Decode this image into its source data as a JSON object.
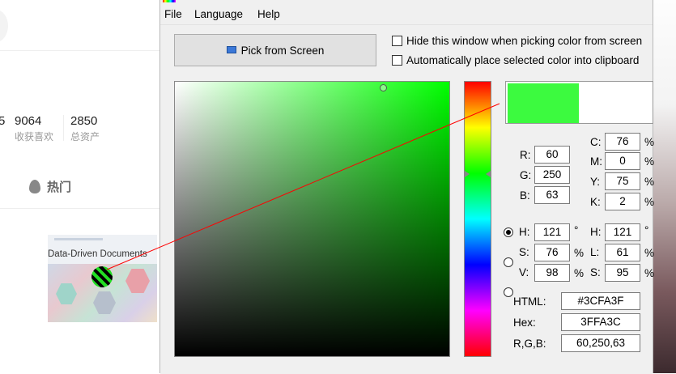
{
  "background_page": {
    "stats": [
      {
        "num": "5",
        "label": ""
      },
      {
        "num": "9064",
        "label": "收获喜欢"
      },
      {
        "num": "2850",
        "label": "总资产"
      }
    ],
    "hot_tab": "热门",
    "thumb_title": "Data-Driven Documents"
  },
  "menu": {
    "file": "File",
    "language": "Language",
    "help": "Help"
  },
  "pick_button": "Pick from Screen",
  "options": {
    "hide_window": "Hide this window when picking color from screen",
    "auto_clipboard": "Automatically place selected color into clipboard"
  },
  "colors": {
    "selected": "#3CFA3F",
    "base_hue": "#00ff00",
    "line": "#ff0000"
  },
  "rgb": {
    "r": "60",
    "g": "250",
    "b": "63"
  },
  "cmyk": {
    "c": "76",
    "m": "0",
    "y": "75",
    "k": "2"
  },
  "hsv": {
    "h": "121",
    "s": "76",
    "v": "98"
  },
  "hsl": {
    "h": "121",
    "l": "61",
    "s": "95"
  },
  "labels": {
    "r": "R:",
    "g": "G:",
    "b": "B:",
    "c": "C:",
    "m": "M:",
    "y": "Y:",
    "k": "K:",
    "h": "H:",
    "s": "S:",
    "v": "V:",
    "l": "L:",
    "percent": "%",
    "degree": "°",
    "html": "HTML:",
    "hex": "Hex:",
    "rgb_triplet": "R,G,B:"
  },
  "codes": {
    "html": "#3CFA3F",
    "hex": "3FFA3C",
    "rgb": "60,250,63"
  }
}
